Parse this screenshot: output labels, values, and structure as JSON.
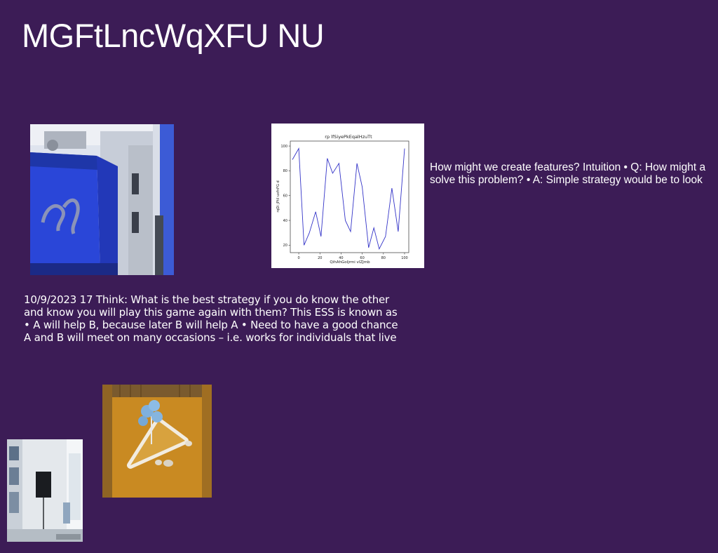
{
  "slide": {
    "title": "MGFtLncWqXFU NU",
    "side_text": [
      "How might we create features? Intuition • Q: How might a",
      "solve this problem? • A: Simple strategy would be to look"
    ],
    "body_text": [
      "10/9/2023 17 Think: What is the best strategy if you do know the other",
      "and know you will play this game again with them? This ESS is known as",
      "• A will help B, because later B will help A • Need to have a good chance",
      "A and B will meet on many occasions – i.e. works for individuals that live"
    ]
  },
  "chart_data": {
    "type": "line",
    "title": "rp lfSiyePkEqalHzuTt",
    "xlabel": "QihAhGoIjrmi vlZJmb",
    "ylabel": "rqDi jPtil uxfnFG d",
    "xlim": [
      -8,
      104
    ],
    "ylim": [
      14,
      104
    ],
    "xticks": [
      0,
      20,
      40,
      60,
      80,
      100
    ],
    "yticks": [
      20,
      40,
      60,
      80,
      100
    ],
    "x": [
      -6,
      0,
      5,
      10,
      16,
      21,
      27,
      32,
      38,
      44,
      49,
      55,
      60,
      66,
      71,
      76,
      82,
      88,
      94,
      100
    ],
    "y": [
      89,
      98,
      20,
      30,
      47,
      27,
      90,
      78,
      86,
      40,
      31,
      86,
      67,
      18,
      34,
      17,
      27,
      66,
      31,
      98
    ],
    "series_color": "#3434c8",
    "grid": false
  }
}
